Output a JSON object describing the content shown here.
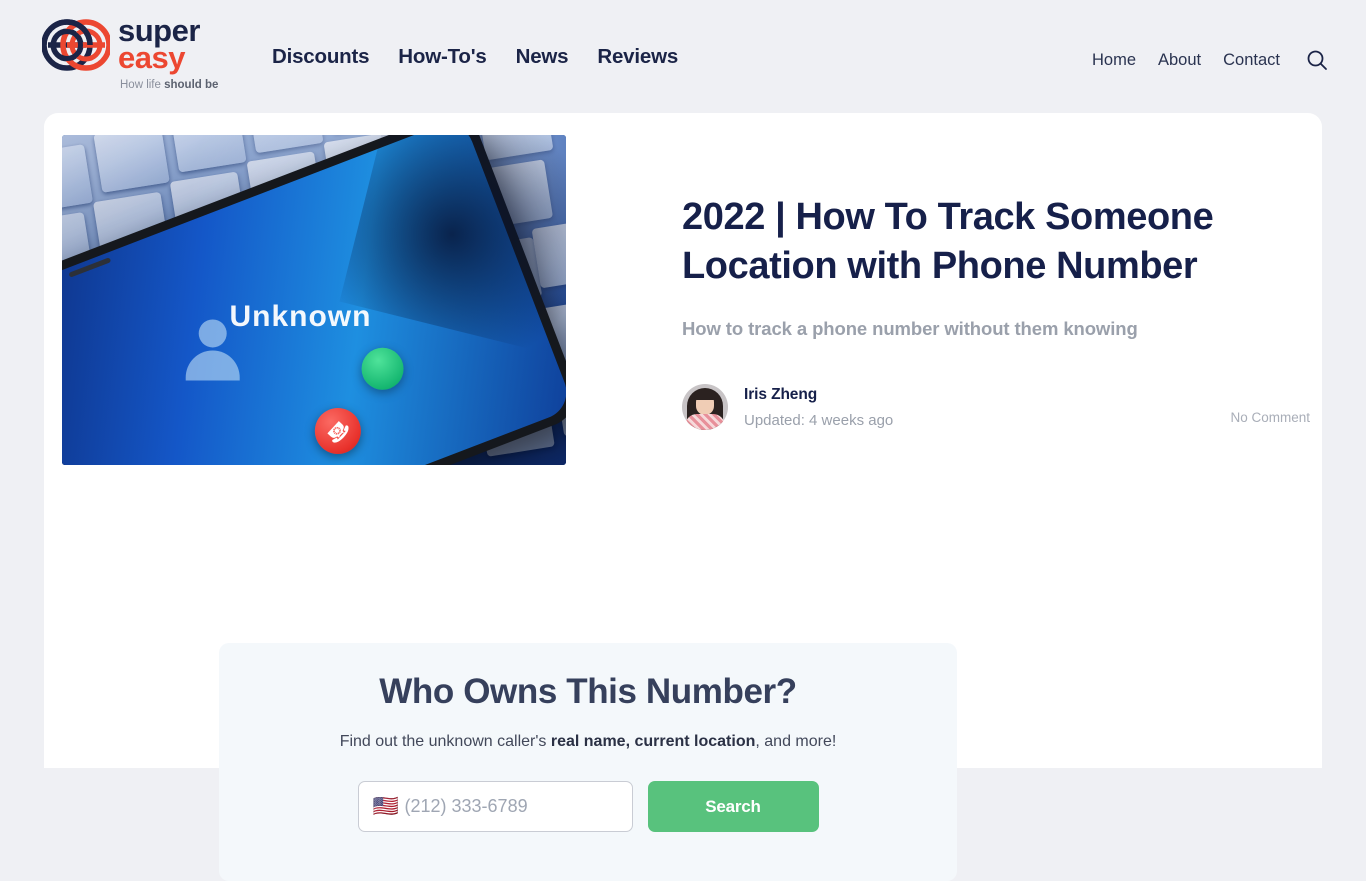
{
  "brand": {
    "logo_icon": "double-e-circles-logo",
    "name_line1": "super",
    "name_line2": "easy",
    "tagline_prefix": "How life ",
    "tagline_bold": "should be",
    "navy": "#1b2447",
    "red": "#ec4731"
  },
  "nav": {
    "main": [
      {
        "label": "Discounts"
      },
      {
        "label": "How-To's"
      },
      {
        "label": "News"
      },
      {
        "label": "Reviews"
      }
    ],
    "right": [
      {
        "label": "Home"
      },
      {
        "label": "About"
      },
      {
        "label": "Contact"
      }
    ],
    "search_icon": "search-icon"
  },
  "article": {
    "hero_image_alt": "Smartphone on a blue computer keyboard showing an incoming call from Unknown",
    "hero_screen_label": "Unknown",
    "title": "2022 | How To Track Someone Location with Phone Number",
    "subtitle": "How to track a phone number without them knowing",
    "author": "Iris Zheng",
    "updated": "Updated: 4 weeks ago",
    "comments": "No Comment"
  },
  "lookup": {
    "title": "Who Owns This Number?",
    "sub_prefix": "Find out the unknown caller's ",
    "sub_bold": "real name, current location",
    "sub_suffix": ", and more!",
    "country_flag": "🇺🇸",
    "phone_value": "",
    "phone_placeholder": "(212) 333-6789",
    "search_label": "Search",
    "button_color": "#58c27d"
  }
}
